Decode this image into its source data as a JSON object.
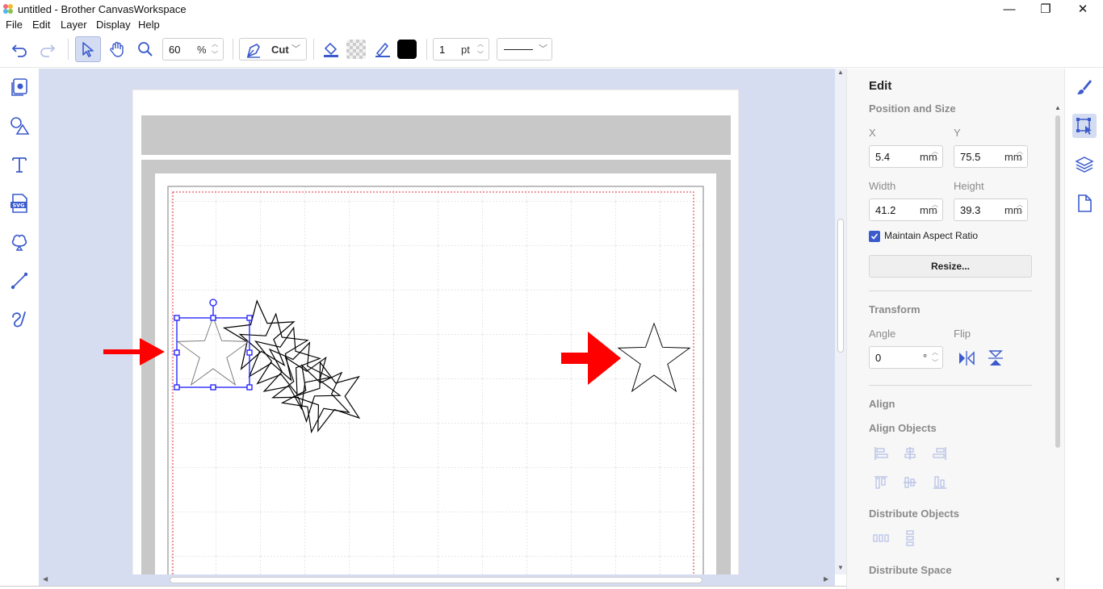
{
  "window": {
    "title": "untitled - Brother CanvasWorkspace",
    "minimize": "—",
    "restore": "❐",
    "close": "✕"
  },
  "menu": [
    "File",
    "Edit",
    "Layer",
    "Display",
    "Help"
  ],
  "toolbar": {
    "zoom_value": "60",
    "zoom_unit": "%",
    "mode_label": "Cut",
    "line_width_value": "1",
    "line_width_unit": "pt",
    "stroke_color": "#000000"
  },
  "left_tools": [
    "pages-icon",
    "shapes-icon",
    "text-icon",
    "svg-import-icon",
    "cut-pattern-icon",
    "line-tool-icon",
    "freehand-icon"
  ],
  "right_panel": {
    "title": "Edit",
    "position_size": {
      "heading": "Position and Size",
      "x_label": "X",
      "x_value": "5.4",
      "y_label": "Y",
      "y_value": "75.5",
      "width_label": "Width",
      "width_value": "41.2",
      "height_label": "Height",
      "height_value": "39.3",
      "unit": "mm",
      "aspect_label": "Maintain Aspect Ratio",
      "aspect_checked": true,
      "resize_label": "Resize..."
    },
    "transform": {
      "heading": "Transform",
      "angle_label": "Angle",
      "angle_value": "0",
      "angle_unit": "°",
      "flip_label": "Flip"
    },
    "align": {
      "heading": "Align",
      "align_objects": "Align Objects",
      "distribute_objects": "Distribute Objects",
      "distribute_space": "Distribute Space"
    }
  },
  "colors": {
    "accent": "#3b5bcc",
    "canvas_bg": "#d6ddf1",
    "selection": "#1a1aff",
    "arrow": "#ff0000",
    "cut_margin": "#e03030"
  }
}
